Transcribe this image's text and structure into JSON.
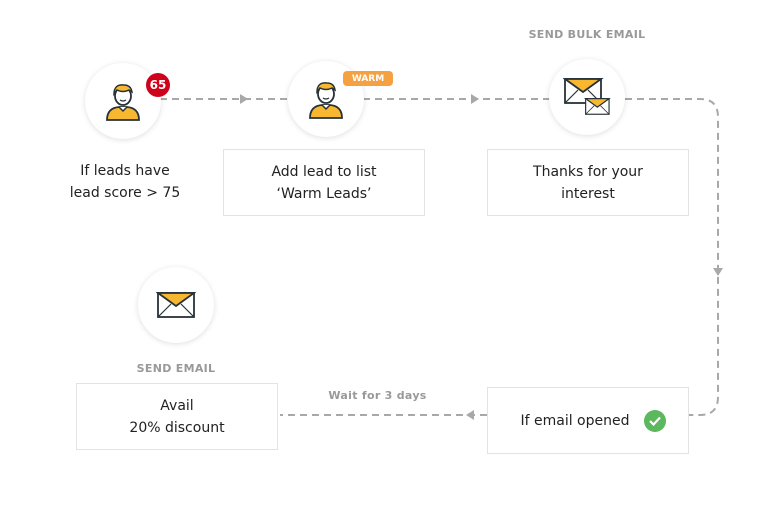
{
  "nodes": {
    "lead_score": {
      "badge": "65",
      "text_line1": "If leads have",
      "text_line2": "lead score > 75",
      "icon": "person-icon"
    },
    "add_to_list": {
      "badge": "WARM",
      "text_line1": "Add lead to list",
      "text_line2": "‘Warm Leads’",
      "icon": "person-icon"
    },
    "bulk_email": {
      "caption": "SEND BULK EMAIL",
      "text_line1": "Thanks for your",
      "text_line2": "interest",
      "icon": "bulk-email-icon"
    },
    "email_opened": {
      "text": "If email opened",
      "icon": "check-circle-icon"
    },
    "send_email": {
      "caption": "SEND EMAIL",
      "text_line1": "Avail",
      "text_line2": "20% discount",
      "icon": "envelope-icon"
    }
  },
  "connectors": {
    "wait_label": "Wait for 3 days"
  },
  "colors": {
    "accent_yellow": "#f7b731",
    "badge_red": "#d0021b",
    "warm_orange": "#f5a142",
    "check_green": "#5cb85c",
    "line_gray": "#a8a8a8"
  }
}
